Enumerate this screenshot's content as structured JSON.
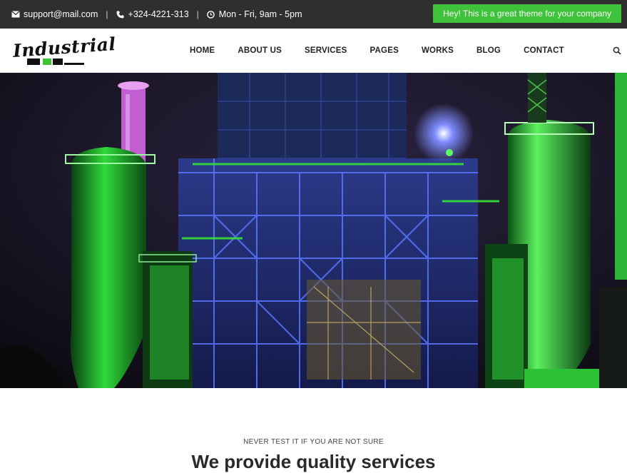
{
  "topbar": {
    "email": "support@mail.com",
    "phone": "+324-4221-313",
    "hours": "Mon - Fri, 9am - 5pm",
    "separator": "|",
    "promo": "Hey! This is a great theme for your company",
    "email_icon": "envelope-icon",
    "phone_icon": "phone-icon",
    "hours_icon": "clock-icon"
  },
  "header": {
    "logo_text": "Industrial",
    "nav": [
      "HOME",
      "ABOUT US",
      "SERVICES",
      "PAGES",
      "WORKS",
      "BLOG",
      "CONTACT"
    ],
    "search_icon": "search-icon"
  },
  "intro": {
    "tagline": "NEVER TEST IT IF YOU ARE NOT SURE",
    "headline": "We provide quality services"
  },
  "colors": {
    "topbar_bg": "#2f2f2f",
    "accent": "#3ec23a",
    "text": "#222222"
  }
}
